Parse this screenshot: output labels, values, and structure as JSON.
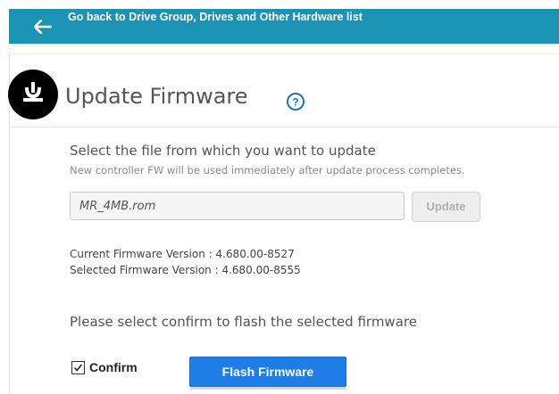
{
  "header": {
    "back_label": "Go back to Drive Group, Drives and Other Hardware list",
    "back_icon": "arrow-left-icon",
    "bar_color": "#1b93b5"
  },
  "title": {
    "text": "Update Firmware",
    "icon": "firmware-download-icon",
    "help_icon": "help-icon",
    "help_color": "#1a73c8"
  },
  "select": {
    "heading": "Select the file from which you want to update",
    "note": "New controller FW will be used immediately after update process completes.",
    "file_value": "MR_4MB.rom",
    "update_label": "Update"
  },
  "firmware": {
    "current": "Current Firmware Version : 4.680.00-8527",
    "selected": "Selected Firmware Version : 4.680.00-8555"
  },
  "confirm": {
    "prompt": "Please select confirm to flash the selected firmware",
    "checkbox_label": "Confirm",
    "checked": true,
    "flash_label": "Flash Firmware",
    "flash_color": "#1f7de8"
  }
}
